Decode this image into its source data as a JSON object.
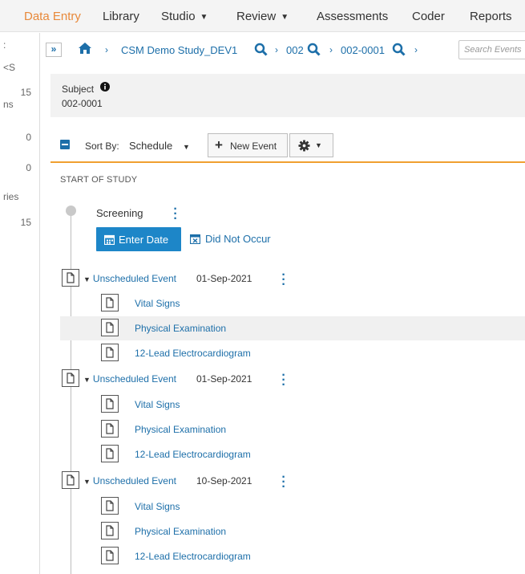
{
  "nav": {
    "items": [
      {
        "label": "Data Entry",
        "active": true,
        "has_caret": false
      },
      {
        "label": "Library",
        "active": false,
        "has_caret": false
      },
      {
        "label": "Studio",
        "active": false,
        "has_caret": true
      },
      {
        "label": "Review",
        "active": false,
        "has_caret": true
      },
      {
        "label": "Assessments",
        "active": false,
        "has_caret": false
      },
      {
        "label": "Coder",
        "active": false,
        "has_caret": false
      },
      {
        "label": "Reports",
        "active": false,
        "has_caret": false
      }
    ]
  },
  "sidebar": {
    "labels": [
      ":",
      "<S",
      "ns",
      "ries"
    ],
    "counts": [
      "15",
      "0",
      "0",
      "15"
    ]
  },
  "breadcrumb": {
    "collapse_glyph": "»",
    "study": "CSM Demo Study_DEV1",
    "site": "002",
    "subject": "002-0001",
    "search_placeholder": "Search Events"
  },
  "subject": {
    "label": "Subject",
    "id": "002-0001"
  },
  "toolbar": {
    "sort_label": "Sort By:",
    "sort_value": "Schedule",
    "new_event_label": "New Event"
  },
  "schedule": {
    "start_label": "START OF STUDY",
    "screening_label": "Screening",
    "enter_date_label": "Enter Date",
    "did_not_occur_label": "Did Not Occur",
    "events": [
      {
        "name": "Unscheduled Event",
        "date": "01-Sep-2021",
        "forms": [
          "Vital Signs",
          "Physical Examination",
          "12-Lead Electrocardiogram"
        ]
      },
      {
        "name": "Unscheduled Event",
        "date": "01-Sep-2021",
        "forms": [
          "Vital Signs",
          "Physical Examination",
          "12-Lead Electrocardiogram"
        ]
      },
      {
        "name": "Unscheduled Event",
        "date": "10-Sep-2021",
        "forms": [
          "Vital Signs",
          "Physical Examination",
          "12-Lead Electrocardiogram"
        ]
      }
    ]
  },
  "colors": {
    "accent_orange": "#e8893a",
    "link_blue": "#1d6fa9",
    "button_blue": "#1d86c8"
  }
}
